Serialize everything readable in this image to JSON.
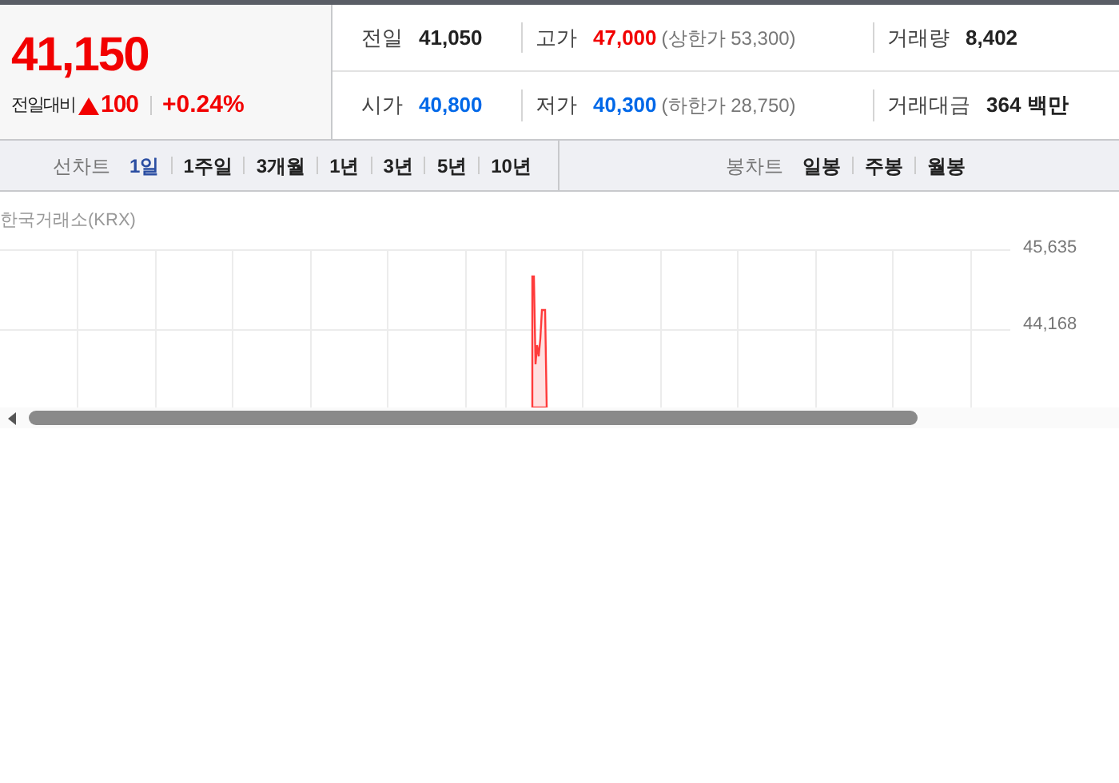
{
  "quote": {
    "price": "41,150",
    "change_label": "전일대비",
    "change": "100",
    "change_rate": "+0.24%"
  },
  "stats": [
    {
      "label": "전일",
      "value": "41,050",
      "color": "#222222"
    },
    {
      "label": "고가",
      "value": "47,000",
      "color": "#f20000",
      "note": "(상한가 53,300)"
    },
    {
      "label": "거래량",
      "value": "8,402",
      "color": "#222222"
    },
    {
      "label": "시가",
      "value": "40,800",
      "color": "#0068e8"
    },
    {
      "label": "저가",
      "value": "40,300",
      "color": "#0068e8",
      "note": "(하한가 28,750)"
    },
    {
      "label": "거래대금",
      "value": "364 백만",
      "color": "#222222"
    }
  ],
  "line_chart_tabs": {
    "label": "선차트",
    "items": [
      {
        "label": "1일",
        "selected": true
      },
      {
        "label": "1주일",
        "selected": false
      },
      {
        "label": "3개월",
        "selected": false
      },
      {
        "label": "1년",
        "selected": false
      },
      {
        "label": "3년",
        "selected": false
      },
      {
        "label": "5년",
        "selected": false
      },
      {
        "label": "10년",
        "selected": false
      }
    ]
  },
  "candle_chart_tabs": {
    "label": "봉차트",
    "items": [
      {
        "label": "일봉",
        "selected": false
      },
      {
        "label": "주봉",
        "selected": false
      },
      {
        "label": "월봉",
        "selected": false
      }
    ]
  },
  "chart": {
    "source": "한국거래소(KRX)",
    "y_labels": [
      "45,635",
      "44,168"
    ]
  }
}
